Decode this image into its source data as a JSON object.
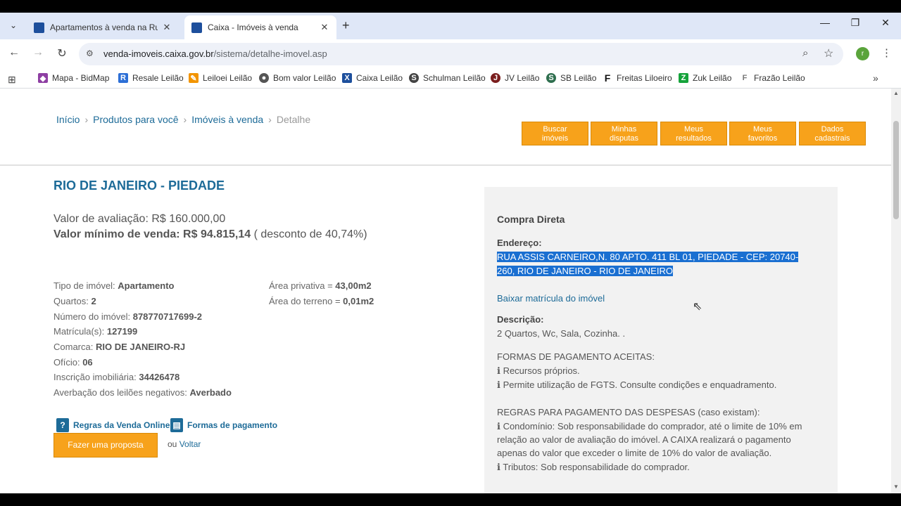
{
  "tabs": [
    {
      "title": "Apartamentos à venda na Rua A",
      "active": false
    },
    {
      "title": "Caixa - Imóveis à venda",
      "active": true
    }
  ],
  "address_bar": {
    "host": "venda-imoveis.caixa.gov.br",
    "path": "/sistema/detalhe-imovel.asp"
  },
  "profile_initial": "r",
  "bookmarks": [
    {
      "label": "Mapa - BidMap",
      "color": "#8e3fa3"
    },
    {
      "label": "Resale Leilão",
      "color": "#2d6fd6"
    },
    {
      "label": "Leiloei Leilão",
      "color": "#f29400"
    },
    {
      "label": "Bom valor Leilão",
      "color": "#555555"
    },
    {
      "label": "Caixa Leilão",
      "color": "#1d4f9c"
    },
    {
      "label": "Schulman Leilão",
      "color": "#444444"
    },
    {
      "label": "JV Leilão",
      "color": "#7b1e1e"
    },
    {
      "label": "SB Leilão",
      "color": "#2f6f4f"
    },
    {
      "label": "Freitas Liloeiro",
      "color": "#111111"
    },
    {
      "label": "Zuk Leilão",
      "color": "#15a33b"
    },
    {
      "label": "Frazão Leilão",
      "color": "#777777"
    }
  ],
  "breadcrumb": [
    "Início",
    "Produtos para você",
    "Imóveis à venda",
    "Detalhe"
  ],
  "top_buttons": [
    [
      "Buscar",
      "imóveis"
    ],
    [
      "Minhas",
      "disputas"
    ],
    [
      "Meus",
      "resultados"
    ],
    [
      "Meus",
      "favoritos"
    ],
    [
      "Dados",
      "cadastrais"
    ]
  ],
  "property": {
    "title": "RIO DE JANEIRO - PIEDADE",
    "valor_avaliacao_label": "Valor de avaliação: ",
    "valor_avaliacao": "R$ 160.000,00",
    "valor_minimo_label": "Valor mínimo de venda: R$ 94.815,14",
    "desconto": " ( desconto de 40,74%)",
    "details_left": [
      {
        "label": "Tipo de imóvel: ",
        "value": "Apartamento"
      },
      {
        "label": "Quartos: ",
        "value": "2"
      },
      {
        "label": "Número do imóvel: ",
        "value": "878770717699-2"
      },
      {
        "label": "Matrícula(s): ",
        "value": "127199"
      },
      {
        "label": "Comarca: ",
        "value": "RIO DE JANEIRO-RJ"
      },
      {
        "label": "Ofício: ",
        "value": "06"
      },
      {
        "label": "Inscrição imobiliária: ",
        "value": "34426478"
      },
      {
        "label": "Averbação dos leilões negativos: ",
        "value": "Averbado"
      }
    ],
    "details_right": [
      {
        "label": "Área privativa = ",
        "value": "43,00m2"
      },
      {
        "label": "Área do terreno = ",
        "value": "0,01m2"
      }
    ],
    "regras_link": "Regras da Venda Online",
    "formas_link": "Formas de pagamento",
    "proposta_button": "Fazer uma proposta",
    "ou": "ou ",
    "voltar": "Voltar"
  },
  "panel": {
    "heading": "Compra Direta",
    "endereco_label": "Endereço:",
    "endereco_line1": "RUA ASSIS CARNEIRO,N. 80 APTO. 411 BL 01, PIEDADE - CEP: 20740-",
    "endereco_line2": "260, RIO DE JANEIRO - RIO DE JANEIRO",
    "matricula_link": "Baixar matrícula do imóvel",
    "descricao_label": "Descrição:",
    "descricao": "2 Quartos, Wc, Sala, Cozinha. .",
    "formas_heading": "FORMAS DE PAGAMENTO ACEITAS:",
    "formas": [
      "Recursos próprios.",
      "Permite utilização de FGTS. Consulte condições e enquadramento."
    ],
    "regras_heading": "REGRAS PARA PAGAMENTO DAS DESPESAS (caso existam):",
    "regras_condominio": [
      "Condomínio: Sob responsabilidade do comprador, até o limite de 10% em",
      "relação ao valor de avaliação do imóvel. A CAIXA realizará o pagamento",
      "apenas do valor que exceder o limite de 10% do valor de avaliação."
    ],
    "regras_tributos": "Tributos: Sob responsabilidade do comprador."
  },
  "colors": {
    "brand_blue": "#1d6b98",
    "orange": "#f7a21b",
    "selection": "#1a6fd1"
  }
}
